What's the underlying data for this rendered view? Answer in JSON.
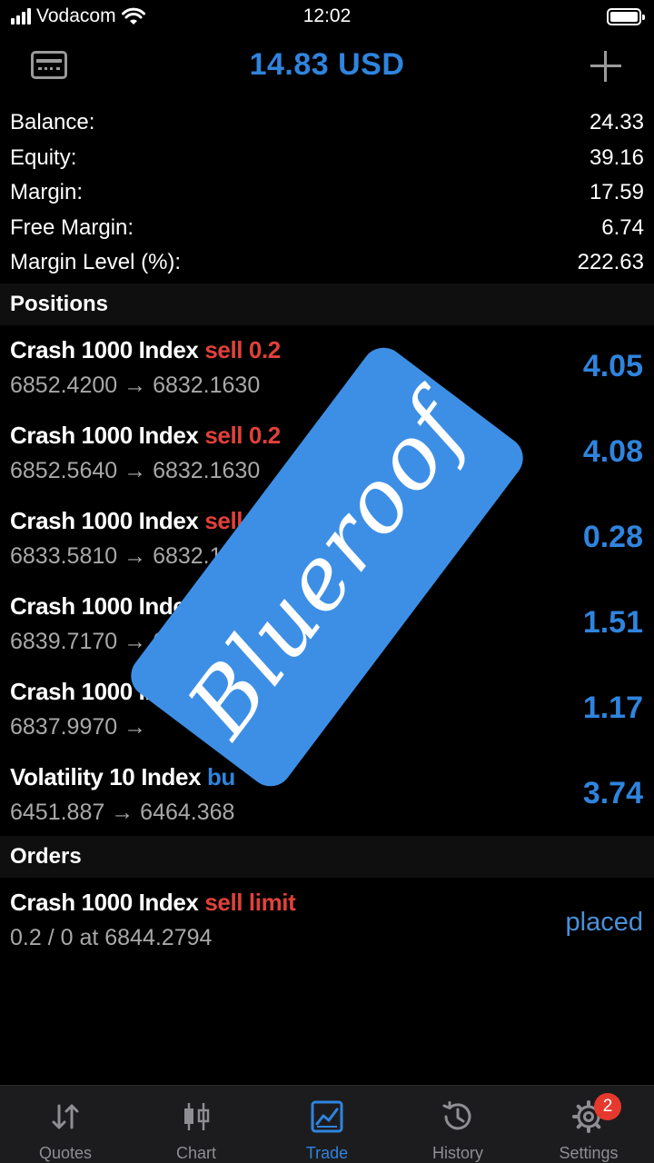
{
  "status_bar": {
    "carrier": "Vodacom",
    "time": "12:02"
  },
  "header": {
    "title": "14.83 USD"
  },
  "summary": [
    {
      "label": "Balance:",
      "value": "24.33"
    },
    {
      "label": "Equity:",
      "value": "39.16"
    },
    {
      "label": "Margin:",
      "value": "17.59"
    },
    {
      "label": "Free Margin:",
      "value": "6.74"
    },
    {
      "label": "Margin Level (%):",
      "value": "222.63"
    }
  ],
  "positions_header": "Positions",
  "positions": [
    {
      "symbol": "Crash 1000 Index",
      "side": "sell 0.2",
      "prices": "6852.4200 → 6832.1630",
      "profit": "4.05"
    },
    {
      "symbol": "Crash 1000 Index",
      "side": "sell 0.2",
      "prices": "6852.5640 → 6832.1630",
      "profit": "4.08"
    },
    {
      "symbol": "Crash 1000 Index",
      "side": "sell 0.2",
      "prices": "6833.5810 → 6832.16",
      "profit": "0.28"
    },
    {
      "symbol": "Crash 1000 Index",
      "side": "sell",
      "prices": "6839.7170 → 683",
      "profit": "1.51"
    },
    {
      "symbol": "Crash 1000 Ind",
      "side": "",
      "prices": "6837.9970 →",
      "profit": "1.17"
    },
    {
      "symbol": "Volatility 10 Index",
      "side": "bu",
      "prices": "6451.887 → 6464.368",
      "profit": "3.74"
    }
  ],
  "orders_header": "Orders",
  "orders": [
    {
      "symbol": "Crash 1000 Index",
      "side": "sell limit",
      "detail": "0.2 / 0 at 6844.2794",
      "status": "placed"
    }
  ],
  "watermark": "Blueroof",
  "tabs": [
    {
      "label": "Quotes",
      "icon": "quotes-arrows-icon"
    },
    {
      "label": "Chart",
      "icon": "candlestick-chart-icon"
    },
    {
      "label": "Trade",
      "icon": "trade-chart-icon",
      "active": true
    },
    {
      "label": "History",
      "icon": "history-clock-icon"
    },
    {
      "label": "Settings",
      "icon": "gear-icon",
      "badge": "2"
    }
  ],
  "colors": {
    "accent": "#2f84de",
    "sell": "#e0413a",
    "badge": "#e5392e",
    "watermark": "#3d8fe6"
  }
}
